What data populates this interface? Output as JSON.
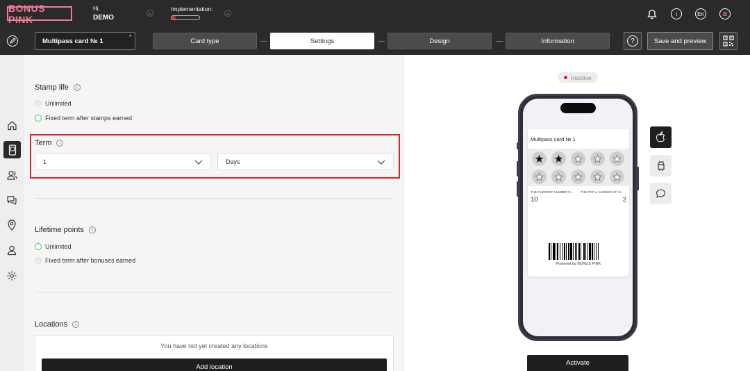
{
  "header": {
    "logo": "BONUS PINK",
    "greeting": "Hi,",
    "user_name": "DEMO",
    "implementation_label": "Implementation:",
    "implementation_progress": 0.15,
    "language": "En",
    "avatar_letter": "B"
  },
  "toolbar": {
    "card_name": "Multipass card № 1",
    "steps": [
      "Card type",
      "Settings",
      "Design",
      "Information"
    ],
    "active_step": "Settings",
    "save_label": "Save and preview"
  },
  "sidebar": {
    "items": [
      "home-icon",
      "card-icon",
      "users-icon",
      "chat-icon",
      "location-icon",
      "profile-icon",
      "settings-icon"
    ],
    "active": "card-icon"
  },
  "form": {
    "stamp_life": {
      "title": "Stamp life",
      "options": [
        "Unlimited",
        "Fixed term after stamps earned"
      ],
      "selected": "Fixed term after stamps earned"
    },
    "term": {
      "title": "Term",
      "value": "1",
      "unit": "Days"
    },
    "lifetime_points": {
      "title": "Lifetime points",
      "options": [
        "Unlimited",
        "Fixed term after bonuses earned"
      ],
      "selected": "Unlimited"
    },
    "locations": {
      "title": "Locations",
      "empty_text": "You have not yet created any locations",
      "add_label": "Add location"
    }
  },
  "preview": {
    "status": "Inactive",
    "status_color": "#d8232a",
    "pass_title": "Multipass card № 1",
    "stamps_total": 10,
    "stamps_filled": 2,
    "field1_label": "THE CURRENT NUMBER O...",
    "field1_value": "10",
    "field2_label": "THE TOTAL NUMBER OF VI...",
    "field2_value": "2",
    "powered_by": "Powered by BONUS PINK",
    "platforms": [
      "apple-icon",
      "android-icon",
      "chat-bubble-icon"
    ],
    "activate_label": "Activate"
  }
}
